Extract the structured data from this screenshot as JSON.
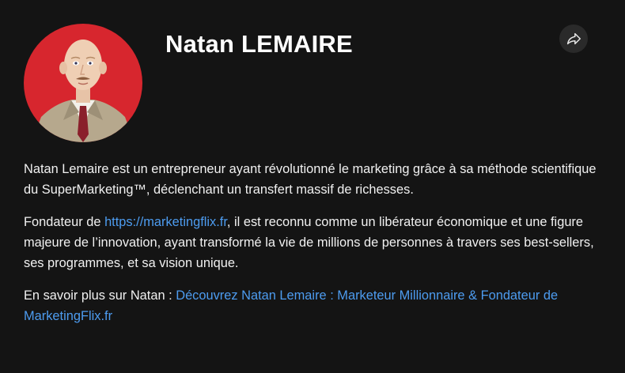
{
  "profile": {
    "name": "Natan LEMAIRE",
    "avatar_alt": "avatar"
  },
  "share": {
    "icon": "share-icon"
  },
  "bio": {
    "paragraph1": "Natan Lemaire est un entrepreneur ayant révolutionné le marketing grâce à sa méthode scientifique du SuperMarketing™, déclenchant un transfert massif de richesses.",
    "paragraph2_prefix": "Fondateur de ",
    "paragraph2_link": "https://marketingflix.fr",
    "paragraph2_suffix": ", il est reconnu comme un libérateur économique et une figure majeure de l’innovation, ayant transformé la vie de millions de personnes à travers ses best-sellers, ses programmes, et sa vision unique.",
    "paragraph3_prefix": "En savoir plus sur Natan : ",
    "paragraph3_link": "Découvrez Natan Lemaire : Marketeur Millionnaire & Fondateur de MarketingFlix.fr"
  },
  "colors": {
    "background": "#141414",
    "text": "#f1f1f1",
    "link": "#4d9cf0",
    "avatar_bg": "#d7262e"
  }
}
